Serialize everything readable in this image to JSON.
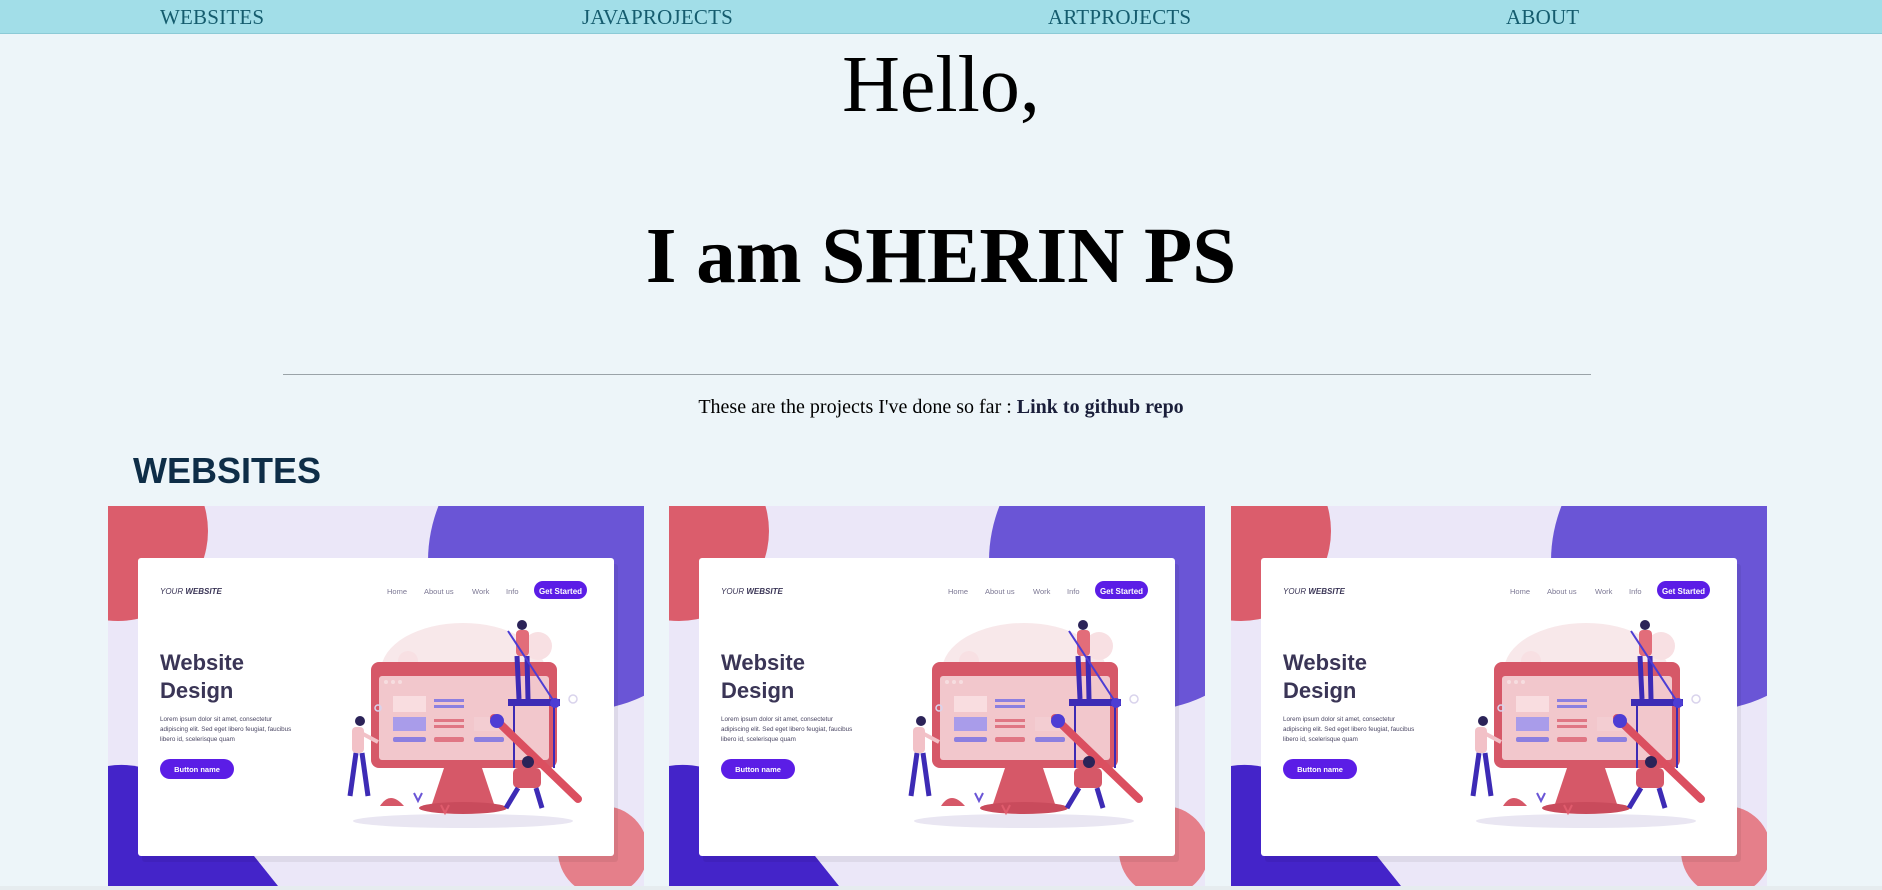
{
  "nav": {
    "websites": "WEBSITES",
    "javaprojects": "JAVAPROJECTS",
    "artprojects": "ARTPROJECTS",
    "about": "ABOUT"
  },
  "hero": {
    "greeting": "Hello,",
    "name": "I am SHERIN PS"
  },
  "intro": {
    "text": "These are the projects I've done so far : ",
    "link_label": "Link to github repo"
  },
  "section": {
    "title": "WEBSITES"
  },
  "card_mock": {
    "logo_prefix": "YOUR",
    "logo_bold": "WEBSITE",
    "menu": [
      "Home",
      "About us",
      "Work",
      "Info"
    ],
    "cta": "Get Started",
    "heading_line1": "Website",
    "heading_line2": "Design",
    "body_line1": "Lorem ipsum dolor sit amet, consectetur",
    "body_line2": "adipiscing elit. Sed eget libero feugiat, faucibus",
    "body_line3": "libero id, scelerisque quam",
    "button": "Button name"
  },
  "colors": {
    "nav_bg": "#a2dee8",
    "page_bg": "#edf5f9",
    "section_title": "#0e2d47",
    "accent_purple": "#5b1de6",
    "blob_red": "#db5d6c",
    "blob_purple": "#6a55d6"
  }
}
